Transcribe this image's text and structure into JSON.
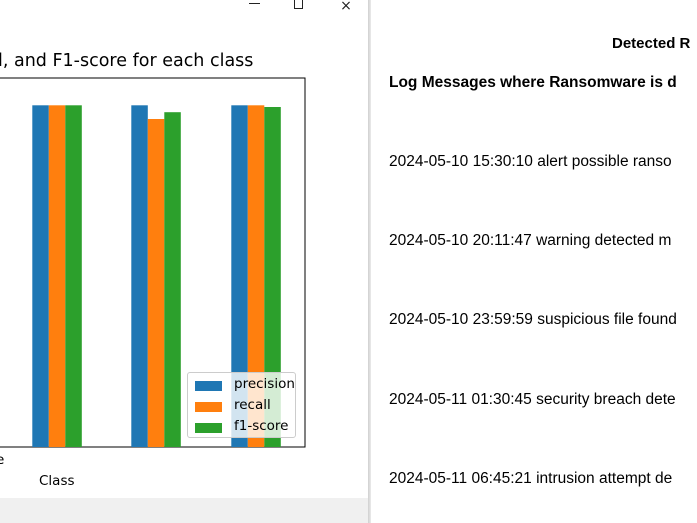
{
  "plot_window": {
    "controls": {
      "minimize": "minimize",
      "maximize": "maximize",
      "close": "×"
    }
  },
  "chart_data": {
    "type": "bar",
    "title": "l, and F1-score for each class",
    "xlabel": "Class",
    "cut_tick_label": "e",
    "categories": [
      "",
      "",
      ""
    ],
    "series": [
      {
        "name": "precision",
        "color": "#1f77b4",
        "values": [
          1.0,
          1.0,
          1.0
        ]
      },
      {
        "name": "recall",
        "color": "#ff7f0e",
        "values": [
          1.0,
          0.96,
          1.0
        ]
      },
      {
        "name": "f1-score",
        "color": "#2ca02c",
        "values": [
          1.0,
          0.98,
          0.995
        ]
      }
    ],
    "ylim": [
      0,
      1.08
    ],
    "grid": false,
    "legend_position": "lower right"
  },
  "report": {
    "title": "Detected R",
    "subtitle": "Log Messages where Ransomware is d",
    "logs": [
      "2024-05-10 15:30:10 alert possible ranso",
      "2024-05-10 20:11:47 warning detected m",
      "2024-05-10 23:59:59 suspicious file found",
      "2024-05-11 01:30:45 security breach dete",
      "2024-05-11 06:45:21 intrusion attempt de"
    ]
  }
}
